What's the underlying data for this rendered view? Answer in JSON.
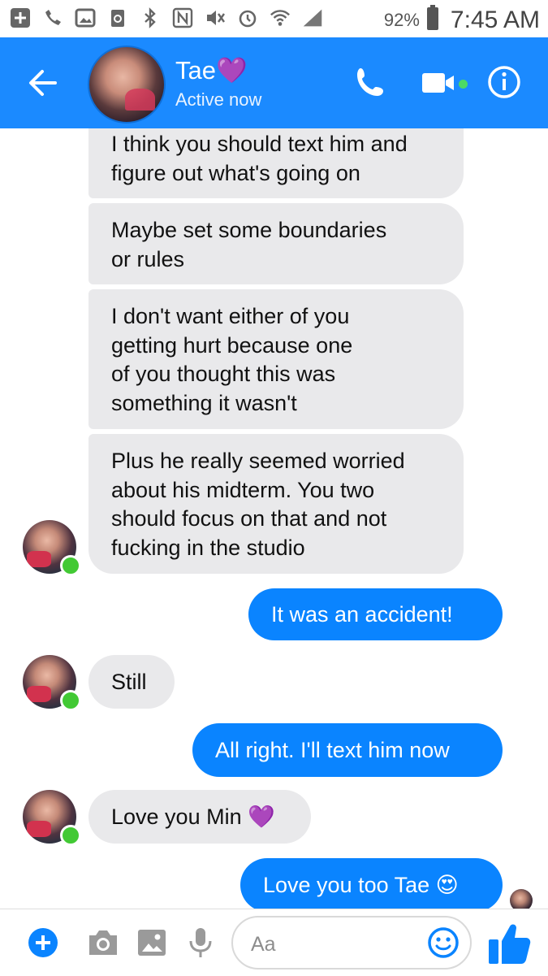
{
  "status_bar": {
    "battery_percent": "92%",
    "time": "7:45 AM"
  },
  "header": {
    "contact_name": "Tae💜",
    "presence": "Active now"
  },
  "messages": [
    {
      "from": "contact",
      "text": "I think you should text him and\nfigure out what's going on"
    },
    {
      "from": "contact",
      "text": "Maybe set some boundaries\nor rules"
    },
    {
      "from": "contact",
      "text": "I don't want either of you\ngetting hurt because one\nof you thought this was\nsomething it wasn't"
    },
    {
      "from": "contact",
      "text": "Plus he really seemed worried\nabout his midterm. You two\nshould focus on that and not\nfucking in the studio"
    },
    {
      "from": "me",
      "text": "It was an accident!"
    },
    {
      "from": "contact",
      "text": "Still"
    },
    {
      "from": "me",
      "text": "All right. I'll text him now"
    },
    {
      "from": "contact",
      "text": "Love you Min 💜"
    },
    {
      "from": "me",
      "text": "Love you too Tae 😍"
    }
  ],
  "composer": {
    "placeholder": "Aa"
  },
  "colors": {
    "brand_blue": "#1b8aff",
    "outgoing_bubble": "#0a84ff",
    "incoming_bubble": "#e9e9eb",
    "online_green": "#42c934"
  }
}
